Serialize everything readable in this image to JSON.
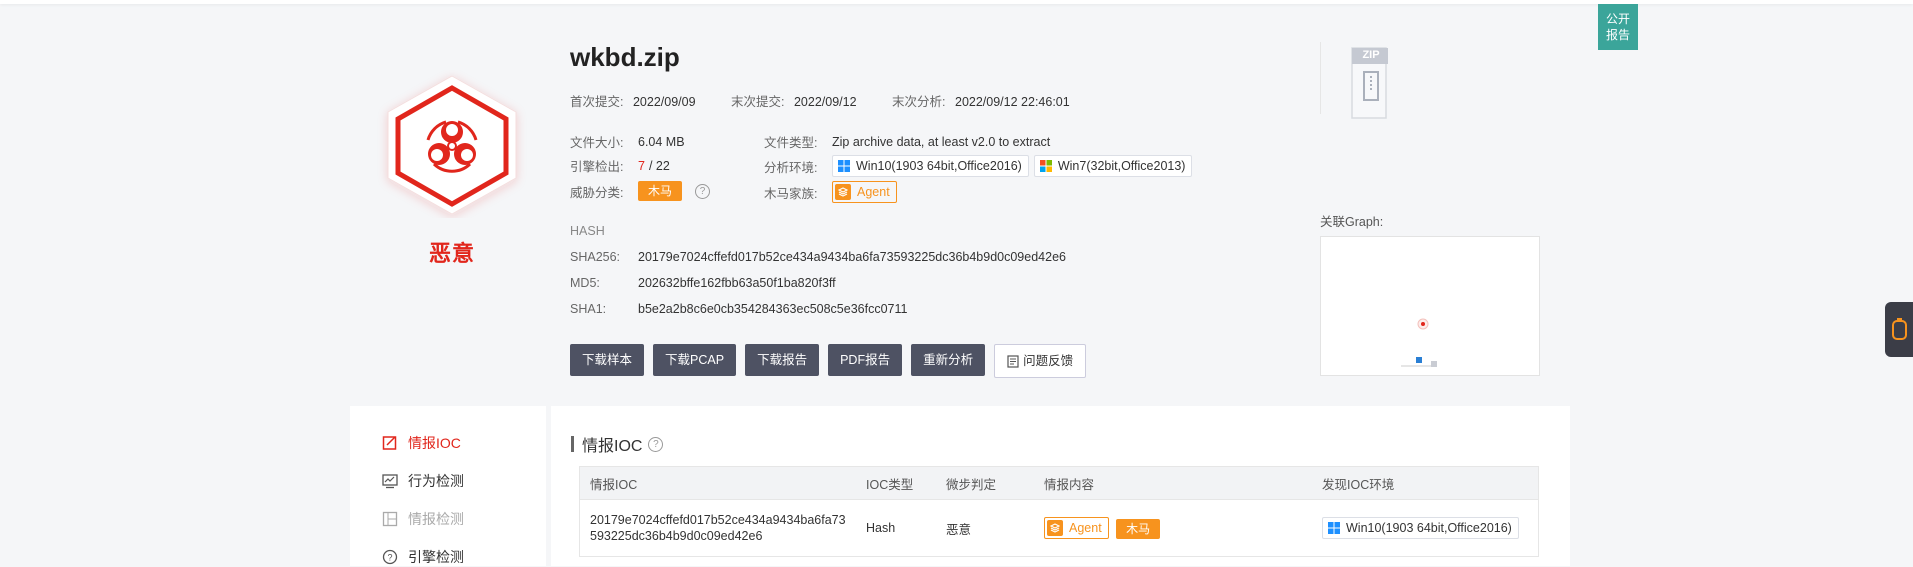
{
  "public_report": "公开\n报告",
  "verdict": "恶意",
  "file": {
    "name": "wkbd.zip",
    "first_submit_label": "首次提交:",
    "first_submit": "2022/09/09",
    "last_submit_label": "末次提交:",
    "last_submit": "2022/09/12",
    "last_analysis_label": "末次分析:",
    "last_analysis": "2022/09/12 22:46:01",
    "size_label": "文件大小:",
    "size": "6.04 MB",
    "type_label": "文件类型:",
    "type": "Zip archive data, at least v2.0 to extract",
    "engine_label": "引擎检出:",
    "engine_hits": "7",
    "engine_total": "/ 22",
    "env_label": "分析环境:",
    "env1": "Win10(1903 64bit,Office2016)",
    "env2": "Win7(32bit,Office2013)",
    "threat_label": "威胁分类:",
    "threat": "木马",
    "family_label": "木马家族:",
    "family": "Agent",
    "help": "?"
  },
  "hash": {
    "title": "HASH",
    "sha256_label": "SHA256:",
    "sha256": "20179e7024cffefd017b52ce434a9434ba6fa73593225dc36b4b9d0c09ed42e6",
    "md5_label": "MD5:",
    "md5": "202632bffe162fbb63a50f1ba820f3ff",
    "sha1_label": "SHA1:",
    "sha1": "b5e2a2b8c6e0cb354284363ec508c5e36fcc0711"
  },
  "buttons": {
    "download_sample": "下载样本",
    "download_pcap": "下载PCAP",
    "download_report": "下载报告",
    "pdf_report": "PDF报告",
    "reanalyze": "重新分析",
    "feedback": "问题反馈"
  },
  "zip_badge": "ZIP",
  "graph_label": "关联Graph:",
  "nav": {
    "items": [
      {
        "label": "情报IOC"
      },
      {
        "label": "行为检测"
      },
      {
        "label": "情报检测"
      },
      {
        "label": "引擎检测"
      }
    ]
  },
  "ioc": {
    "title": "情报IOC",
    "columns": [
      "情报IOC",
      "IOC类型",
      "微步判定",
      "情报内容",
      "发现IOC环境"
    ],
    "rows": [
      {
        "ioc": "20179e7024cffefd017b52ce434a9434ba6fa73593225dc36b4b9d0c09ed42e6",
        "type": "Hash",
        "verdict": "恶意",
        "family": "Agent",
        "category": "木马",
        "env": "Win10(1903 64bit,Office2016)"
      }
    ]
  },
  "colors": {
    "malicious": "#e1261c",
    "accent_orange": "#f7931e",
    "button_dark": "#4e5263",
    "teal": "#3ba59a"
  }
}
